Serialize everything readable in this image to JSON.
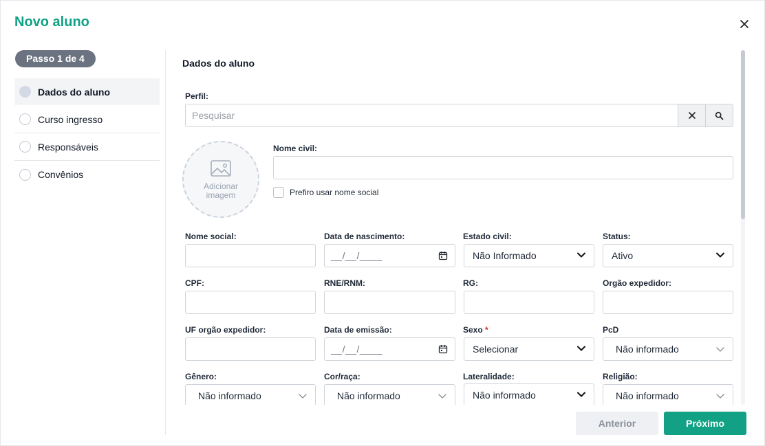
{
  "modal": {
    "title": "Novo aluno",
    "accent_color": "#12a184"
  },
  "stepper": {
    "badge": "Passo 1 de 4",
    "steps": [
      {
        "label": "Dados do aluno",
        "active": true
      },
      {
        "label": "Curso ingresso",
        "active": false
      },
      {
        "label": "Responsáveis",
        "active": false
      },
      {
        "label": "Convênios",
        "active": false
      }
    ]
  },
  "section": {
    "title": "Dados do aluno"
  },
  "perfil": {
    "label": "Perfil:",
    "placeholder": "Pesquisar"
  },
  "avatar": {
    "label": "Adicionar imagem"
  },
  "nome_civil": {
    "label": "Nome civil:",
    "value": ""
  },
  "nome_social_pref": {
    "label": "Prefiro usar nome social",
    "checked": false
  },
  "fields": {
    "nome_social": {
      "label": "Nome social:",
      "value": ""
    },
    "data_nascimento": {
      "label": "Data de nascimento:",
      "value": "__/__/____"
    },
    "estado_civil": {
      "label": "Estado civil:",
      "value": "Não Informado"
    },
    "status": {
      "label": "Status:",
      "value": "Ativo"
    },
    "cpf": {
      "label": "CPF:",
      "value": ""
    },
    "rne": {
      "label": "RNE/RNM:",
      "value": ""
    },
    "rg": {
      "label": "RG:",
      "value": ""
    },
    "orgao_expedidor": {
      "label": "Orgão expedidor:",
      "value": ""
    },
    "uf_orgao": {
      "label": "UF orgão expedidor:",
      "value": ""
    },
    "data_emissao": {
      "label": "Data de emissão:",
      "value": "__/__/____"
    },
    "sexo": {
      "label": "Sexo",
      "required_mark": "*",
      "value": "Selecionar"
    },
    "pcd": {
      "label": "PcD",
      "value": "Não informado"
    },
    "genero": {
      "label": "Gênero:",
      "value": "Não informado"
    },
    "cor_raca": {
      "label": "Cor/raça:",
      "value": "Não informado"
    },
    "lateralidade": {
      "label": "Lateralidade:",
      "value": "Não informado"
    },
    "religiao": {
      "label": "Religião:",
      "value": "Não informado"
    }
  },
  "footer": {
    "prev_label": "Anterior",
    "next_label": "Próximo"
  }
}
